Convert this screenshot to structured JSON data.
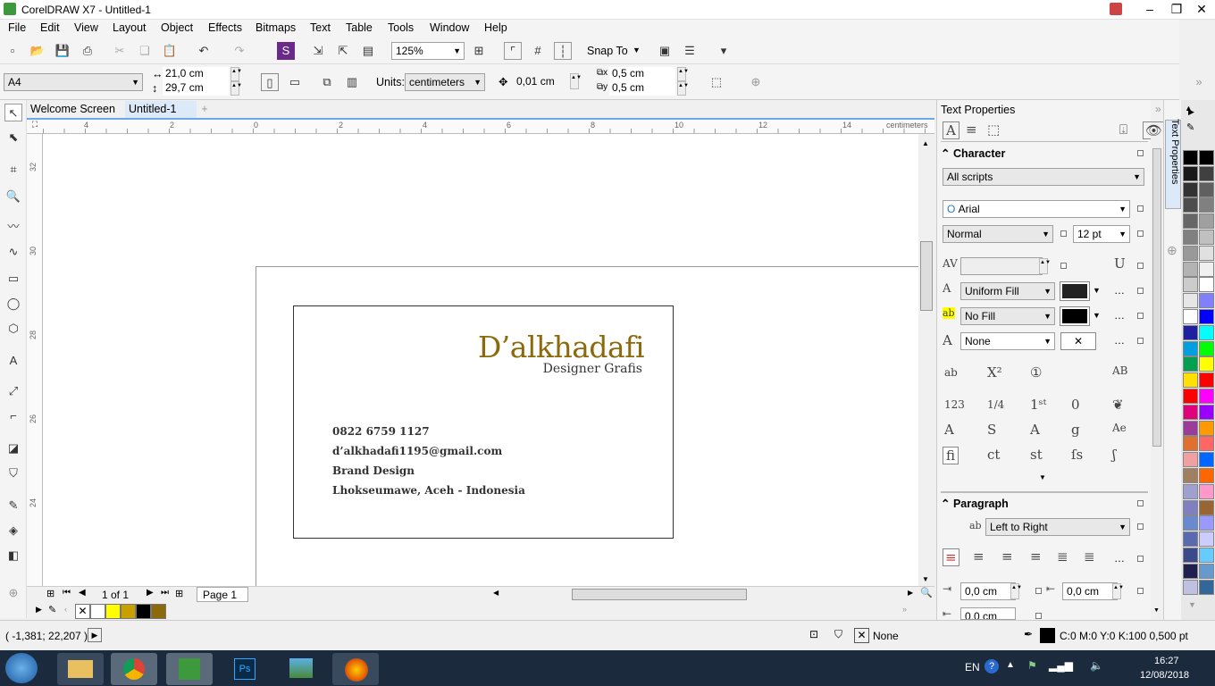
{
  "app": {
    "title": "CorelDRAW X7 - Untitled-1"
  },
  "menu": [
    "File",
    "Edit",
    "View",
    "Layout",
    "Object",
    "Effects",
    "Bitmaps",
    "Text",
    "Table",
    "Tools",
    "Window",
    "Help"
  ],
  "toolbar": {
    "zoom": "125%",
    "snap_to": "Snap To"
  },
  "propbar": {
    "page_size": "A4",
    "width": "21,0 cm",
    "height": "29,7 cm",
    "units_label": "Units:",
    "units": "centimeters",
    "nudge": "0,01 cm",
    "dup_x": "0,5 cm",
    "dup_y": "0,5 cm"
  },
  "tabs": {
    "welcome": "Welcome Screen",
    "doc": "Untitled-1"
  },
  "ruler": {
    "unit": "centimeters",
    "h_ticks": [
      "4",
      "2",
      "0",
      "2",
      "4",
      "6",
      "8",
      "10",
      "12",
      "14"
    ],
    "v_ticks": [
      "32",
      "30",
      "28",
      "26",
      "24"
    ]
  },
  "card": {
    "brand": "D’alkhadafi",
    "subtitle": "Designer Grafis",
    "phone": "0822 6759 1127",
    "email": "d’alkhadafi1195@gmail.com",
    "service": "Brand Design",
    "location": "Lhokseumawe, Aceh - Indonesia"
  },
  "pagenav": {
    "count": "1 of 1",
    "page_tab": "Page 1"
  },
  "status": {
    "coords": "( -1,381; 22,207 )",
    "fill_none": "None",
    "outline": "C:0 M:0 Y:0 K:100  0,500 pt"
  },
  "docker": {
    "title": "Text Properties",
    "side_tab": "Text Properties",
    "character": {
      "header": "Character",
      "scripts": "All scripts",
      "font": "Arial",
      "style": "Normal",
      "size": "12 pt",
      "fill_type": "Uniform Fill",
      "bg_fill": "No Fill",
      "outline": "None"
    },
    "paragraph": {
      "header": "Paragraph",
      "direction": "Left to Right",
      "indent1": "0,0 cm",
      "indent2": "0,0 cm",
      "indent3": "0,0 cm"
    }
  },
  "taskbar": {
    "lang": "EN",
    "time": "16:27",
    "date": "12/08/2018"
  },
  "colors": {
    "brand": "#8c6a0b",
    "accent": "#3c9a3c",
    "taskbar": "#1b2a3c"
  }
}
